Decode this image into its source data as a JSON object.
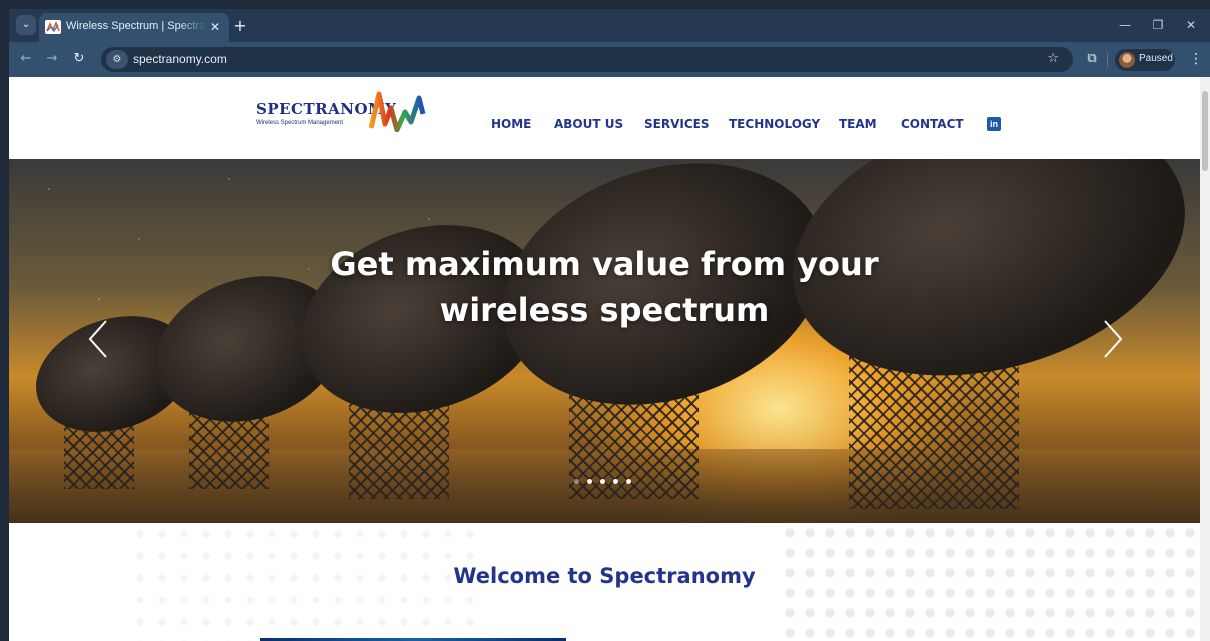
{
  "browser": {
    "tab_title": "Wireless Spectrum | Spectranomy",
    "url": "spectranomy.com",
    "profile_status": "Paused"
  },
  "site": {
    "logo_name": "SPECTRANOMY",
    "logo_tagline": "Wireless Spectrum Management",
    "nav": [
      "HOME",
      "ABOUT US",
      "SERVICES",
      "TECHNOLOGY",
      "TEAM",
      "CONTACT"
    ],
    "social_icon": "linkedin-icon",
    "brand_color": "#23348c"
  },
  "hero": {
    "title_line1": "Get maximum value from your",
    "title_line2": "wireless spectrum",
    "slide_count": 5,
    "active_slide": 1
  },
  "welcome": {
    "title": "Welcome to Spectranomy"
  }
}
